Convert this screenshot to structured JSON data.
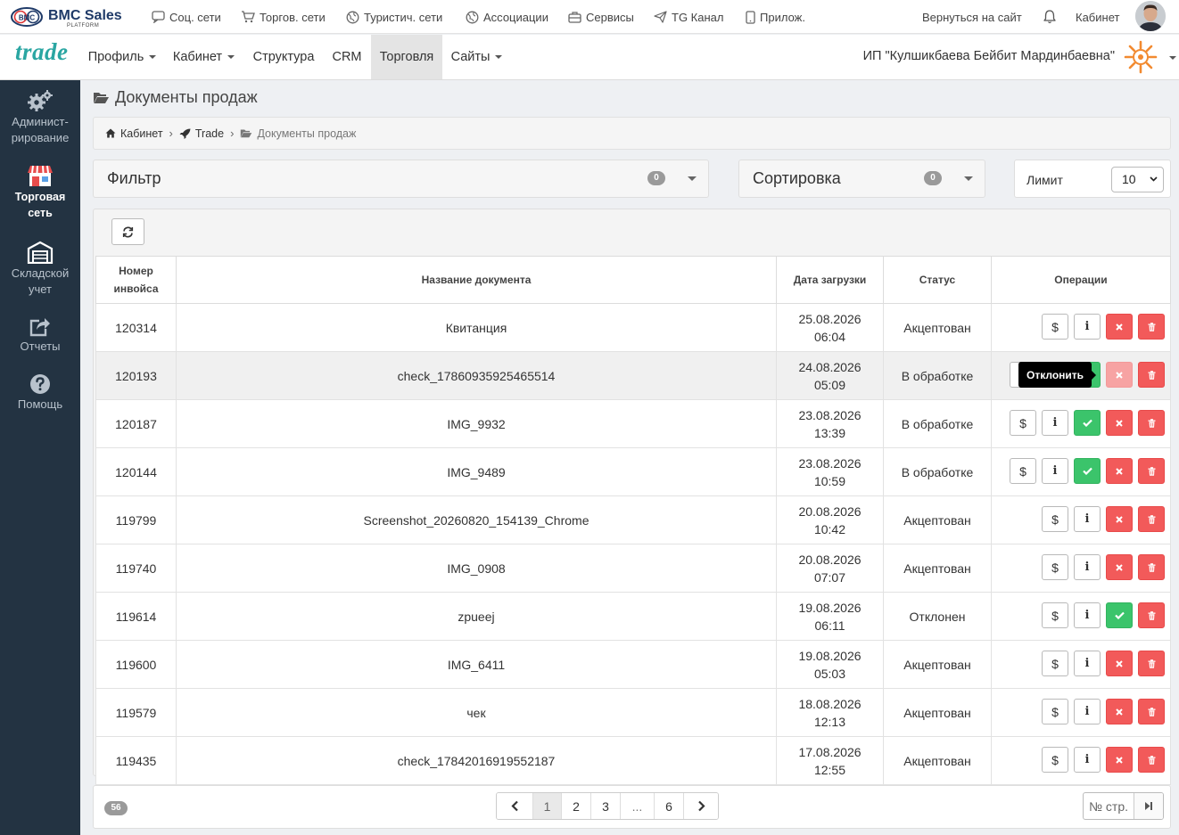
{
  "topbar": {
    "logo_text": "BMC Sales",
    "logo_sub": "PLATFORM",
    "links": [
      {
        "label": "Соц. сети",
        "icon": "chat-icon"
      },
      {
        "label": "Торгов. сети",
        "icon": "cart-icon"
      },
      {
        "label": "Туристич. сети",
        "icon": "globe-icon"
      },
      {
        "label": "Ассоциации",
        "icon": "globe-icon"
      },
      {
        "label": "Сервисы",
        "icon": "briefcase-icon"
      },
      {
        "label": "TG Канал",
        "icon": "send-icon"
      },
      {
        "label": "Прилож.",
        "icon": "mobile-icon"
      }
    ],
    "back_to_site": "Вернуться на сайт",
    "cabinet": "Кабинет"
  },
  "navbar": {
    "brand": "trade",
    "items": [
      {
        "label": "Профиль",
        "dropdown": true
      },
      {
        "label": "Кабинет",
        "dropdown": true
      },
      {
        "label": "Структура",
        "dropdown": false
      },
      {
        "label": "CRM",
        "dropdown": false
      },
      {
        "label": "Торговля",
        "dropdown": false,
        "active": true
      },
      {
        "label": "Сайты",
        "dropdown": true
      }
    ],
    "company": "ИП \"Кулшикбаева Бейбит Мардинбаевна\""
  },
  "sidebar": {
    "items": [
      {
        "label1": "Админист-",
        "label2": "рирование",
        "icon": "gears-icon"
      },
      {
        "label1": "Торговая",
        "label2": "сеть",
        "icon": "store-icon",
        "active": true
      },
      {
        "label1": "Складской",
        "label2": "учет",
        "icon": "warehouse-icon"
      },
      {
        "label1": "Отчеты",
        "label2": "",
        "icon": "share-icon"
      },
      {
        "label1": "Помощь",
        "label2": "",
        "icon": "help-icon"
      }
    ]
  },
  "page": {
    "title": "Документы продаж",
    "breadcrumb": [
      "Кабинет",
      "Trade",
      "Документы продаж"
    ]
  },
  "filter": {
    "label": "Фильтр",
    "count": "0"
  },
  "sort": {
    "label": "Сортировка",
    "count": "0"
  },
  "limit": {
    "label": "Лимит",
    "value": "10"
  },
  "table": {
    "columns": [
      "Номер инвойса",
      "Название документа",
      "Дата загрузки",
      "Статус",
      "Операции"
    ],
    "col_number_1": "Номер",
    "col_number_2": "инвойса",
    "rows": [
      {
        "id": "120314",
        "name": "Квитанция",
        "date": "25.08.2026",
        "time": "06:04",
        "status": "Акцептован",
        "ops": [
          "pay",
          "info",
          "reject",
          "delete"
        ]
      },
      {
        "id": "120193",
        "name": "check_17860935925465514",
        "date": "24.08.2026",
        "time": "05:09",
        "status": "В обработке",
        "ops": [
          "pay",
          "info",
          "accept",
          "reject",
          "delete"
        ],
        "hover": true
      },
      {
        "id": "120187",
        "name": "IMG_9932",
        "date": "23.08.2026",
        "time": "13:39",
        "status": "В обработке",
        "ops": [
          "pay",
          "info",
          "accept",
          "reject",
          "delete"
        ]
      },
      {
        "id": "120144",
        "name": "IMG_9489",
        "date": "23.08.2026",
        "time": "10:59",
        "status": "В обработке",
        "ops": [
          "pay",
          "info",
          "accept",
          "reject",
          "delete"
        ]
      },
      {
        "id": "119799",
        "name": "Screenshot_20260820_154139_Chrome",
        "date": "20.08.2026",
        "time": "10:42",
        "status": "Акцептован",
        "ops": [
          "pay",
          "info",
          "reject",
          "delete"
        ]
      },
      {
        "id": "119740",
        "name": "IMG_0908",
        "date": "20.08.2026",
        "time": "07:07",
        "status": "Акцептован",
        "ops": [
          "pay",
          "info",
          "reject",
          "delete"
        ]
      },
      {
        "id": "119614",
        "name": "zpueej",
        "date": "19.08.2026",
        "time": "06:11",
        "status": "Отклонен",
        "ops": [
          "pay",
          "info",
          "accept",
          "delete"
        ]
      },
      {
        "id": "119600",
        "name": "IMG_6411",
        "date": "19.08.2026",
        "time": "05:03",
        "status": "Акцептован",
        "ops": [
          "pay",
          "info",
          "reject",
          "delete"
        ]
      },
      {
        "id": "119579",
        "name": "чек",
        "date": "18.08.2026",
        "time": "12:13",
        "status": "Акцептован",
        "ops": [
          "pay",
          "info",
          "reject",
          "delete"
        ]
      },
      {
        "id": "119435",
        "name": "check_17842016919552187",
        "date": "17.08.2026",
        "time": "12:55",
        "status": "Акцептован",
        "ops": [
          "pay",
          "info",
          "reject",
          "delete"
        ]
      }
    ],
    "tooltip": "Отклонить"
  },
  "footer": {
    "total": "56",
    "pages": [
      "1",
      "2",
      "3",
      "...",
      "6"
    ],
    "current_page": "1",
    "goto_placeholder": "№ стр."
  },
  "colors": {
    "brand": "#2aa6a2",
    "sidebar": "#233342",
    "accept": "#3bc46b",
    "reject": "#f25a5a"
  }
}
